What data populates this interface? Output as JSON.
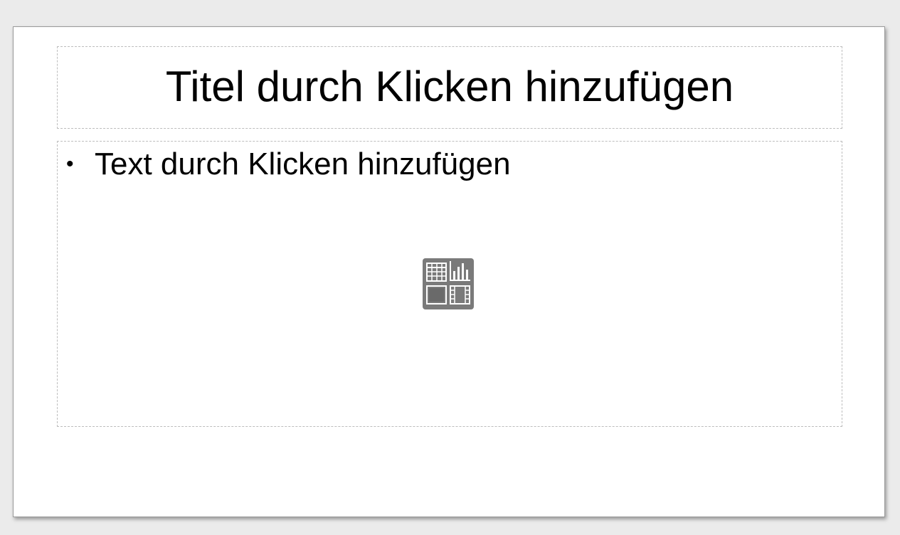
{
  "slide": {
    "title_placeholder": "Titel durch Klicken hinzufügen",
    "content_placeholder": "Text durch Klicken hinzufügen",
    "bullet": "•"
  },
  "insert_icon": {
    "icons": [
      "table-icon",
      "chart-icon",
      "image-icon",
      "video-icon"
    ]
  },
  "colors": {
    "workspace_bg": "#ebebeb",
    "slide_bg": "#ffffff",
    "placeholder_border": "#bdbdbd",
    "icon_bg": "#7a7a7a"
  }
}
